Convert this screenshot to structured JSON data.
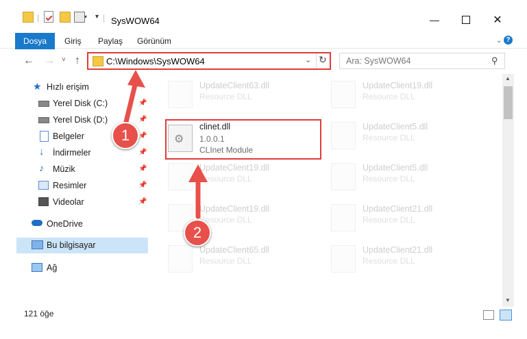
{
  "window": {
    "title": "SysWOW64"
  },
  "ribbon": {
    "tabs": [
      "Dosya",
      "Giriş",
      "Paylaş",
      "Görünüm"
    ]
  },
  "address": {
    "path": "C:\\Windows\\SysWOW64"
  },
  "search": {
    "placeholder": "Ara: SysWOW64"
  },
  "sidebar": {
    "items": [
      {
        "label": "Hızlı erişim",
        "icon": "star-icon"
      },
      {
        "label": "Yerel Disk (C:)",
        "icon": "drive-icon",
        "pinned": true
      },
      {
        "label": "Yerel Disk (D:)",
        "icon": "drive-icon",
        "pinned": true
      },
      {
        "label": "Belgeler",
        "icon": "documents-icon",
        "pinned": true
      },
      {
        "label": "İndirmeler",
        "icon": "download-icon",
        "pinned": true
      },
      {
        "label": "Müzik",
        "icon": "music-icon",
        "pinned": true
      },
      {
        "label": "Resimler",
        "icon": "pictures-icon",
        "pinned": true
      },
      {
        "label": "Videolar",
        "icon": "videos-icon",
        "pinned": true
      },
      {
        "label": "OneDrive",
        "icon": "cloud-icon"
      },
      {
        "label": "Bu bilgisayar",
        "icon": "computer-icon",
        "selected": true
      },
      {
        "label": "Ağ",
        "icon": "network-icon"
      }
    ]
  },
  "files": {
    "left": [
      {
        "name": "UpdateClient63.dll",
        "desc": "Resource DLL"
      },
      {
        "name": "clinet.dll",
        "version": "1.0.0.1",
        "desc": "CLInet Module"
      },
      {
        "name": "UpdateClient19.dll",
        "desc": "Resource DLL"
      },
      {
        "name": "UpdateClient19.dll",
        "desc": "Resource DLL"
      },
      {
        "name": "UpdateClient65.dll",
        "desc": "Resource DLL"
      }
    ],
    "right": [
      {
        "name": "UpdateClient19.dll",
        "desc": "Resource DLL"
      },
      {
        "name": "UpdateClient5.dll",
        "desc": "Resource DLL"
      },
      {
        "name": "UpdateClient5.dll",
        "desc": "Resource DLL"
      },
      {
        "name": "UpdateClient21.dll",
        "desc": "Resource DLL"
      },
      {
        "name": "UpdateClient21.dll",
        "desc": "Resource DLL"
      }
    ]
  },
  "status": {
    "count": "121 öğe"
  },
  "annotations": {
    "step1": "1",
    "step2": "2"
  },
  "colors": {
    "accent": "#1979ca",
    "highlight": "#e03a3a",
    "selected": "#cce4f7"
  }
}
